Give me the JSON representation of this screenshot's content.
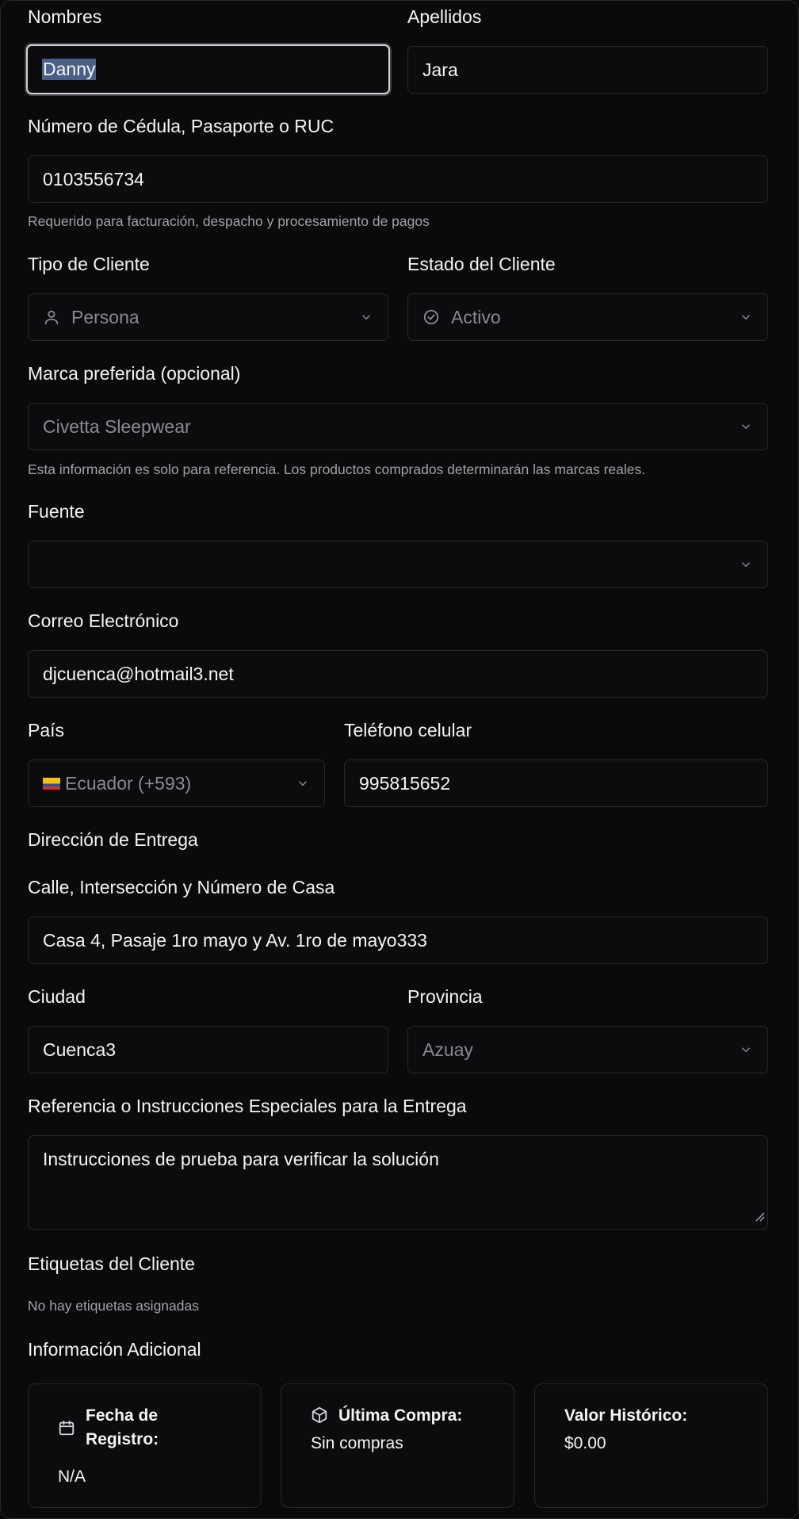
{
  "form": {
    "nombres": {
      "label": "Nombres",
      "value": "Danny"
    },
    "apellidos": {
      "label": "Apellidos",
      "value": "Jara"
    },
    "cedula": {
      "label": "Número de Cédula, Pasaporte o RUC",
      "value": "0103556734",
      "help": "Requerido para facturación, despacho y procesamiento de pagos"
    },
    "tipo_cliente": {
      "label": "Tipo de Cliente",
      "value": "Persona",
      "icon": "user-icon"
    },
    "estado_cliente": {
      "label": "Estado del Cliente",
      "value": "Activo",
      "icon": "check-circle-icon"
    },
    "marca": {
      "label": "Marca preferida (opcional)",
      "value": "Civetta Sleepwear",
      "help": "Esta información es solo para referencia. Los productos comprados determinarán las marcas reales."
    },
    "fuente": {
      "label": "Fuente",
      "value": ""
    },
    "correo": {
      "label": "Correo Electrónico",
      "value": "djcuenca@hotmail3.net"
    },
    "pais": {
      "label": "País",
      "value": "Ecuador (+593)",
      "flag": "ecuador-flag"
    },
    "telefono": {
      "label": "Teléfono celular",
      "value": "995815652"
    },
    "direccion_title": "Dirección de Entrega",
    "calle": {
      "label": "Calle, Intersección y Número de Casa",
      "value": "Casa 4, Pasaje 1ro mayo y Av. 1ro de mayo333"
    },
    "ciudad": {
      "label": "Ciudad",
      "value": "Cuenca3"
    },
    "provincia": {
      "label": "Provincia",
      "value": "Azuay"
    },
    "referencia": {
      "label": "Referencia o Instrucciones Especiales para la Entrega",
      "value": "Instrucciones de prueba para verificar la solución"
    },
    "etiquetas": {
      "label": "Etiquetas del Cliente",
      "empty": "No hay etiquetas asignadas"
    }
  },
  "info": {
    "title": "Información Adicional",
    "cards": [
      {
        "title": "Fecha de Registro:",
        "value": "N/A",
        "icon": "calendar-icon"
      },
      {
        "title": "Última Compra:",
        "value": "Sin compras",
        "icon": "box-icon"
      },
      {
        "title": "Valor Histórico:",
        "value": "$0.00"
      }
    ]
  },
  "colors": {
    "background": "#0a0a0b",
    "border": "#27272a",
    "muted": "#a1a1aa",
    "selection": "#4a5f86"
  }
}
